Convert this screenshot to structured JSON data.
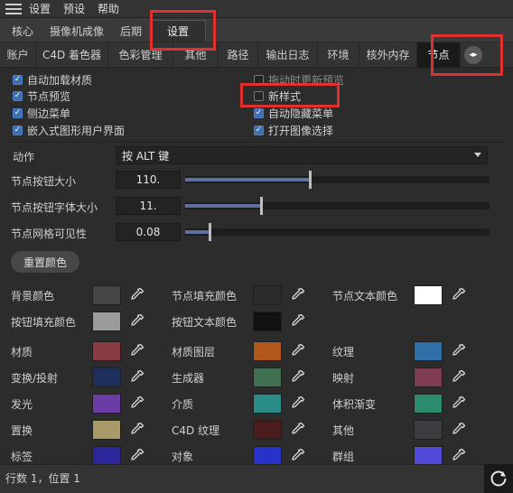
{
  "menubar": {
    "items": [
      "设置",
      "预设",
      "帮助"
    ]
  },
  "tabs_main": [
    {
      "label": "核心",
      "active": false
    },
    {
      "label": "摄像机成像",
      "active": false
    },
    {
      "label": "后期",
      "active": false
    },
    {
      "label": "设置",
      "active": true
    }
  ],
  "tabs_sub": [
    {
      "label": "账户",
      "active": false
    },
    {
      "label": "C4D 着色器",
      "active": false
    },
    {
      "label": "色彩管理",
      "active": false
    },
    {
      "label": "其他",
      "active": false
    },
    {
      "label": "路径",
      "active": false
    },
    {
      "label": "输出日志",
      "active": false
    },
    {
      "label": "环境",
      "active": false
    },
    {
      "label": "核外内存",
      "active": false
    },
    {
      "label": "节点",
      "active": true
    }
  ],
  "checkboxes": [
    {
      "label": "自动加载材质",
      "checked": true
    },
    {
      "label": "节点预览",
      "checked": true
    },
    {
      "label": "侧边菜单",
      "checked": true
    },
    {
      "label": "嵌入式图形用户界面",
      "checked": true
    },
    {
      "label": "拖动时更新预览",
      "checked": false
    },
    {
      "label": "新样式",
      "checked": false
    },
    {
      "label": "自动隐藏菜单",
      "checked": true
    },
    {
      "label": "打开图像选择",
      "checked": true
    }
  ],
  "action": {
    "label": "动作",
    "value": "按 ALT 键"
  },
  "sliders": [
    {
      "label": "节点按钮大小",
      "value": "110.",
      "fraction": 0.41
    },
    {
      "label": "节点按钮字体大小",
      "value": "11.",
      "fraction": 0.25
    },
    {
      "label": "节点网格可见性",
      "value": "0.08",
      "fraction": 0.08
    }
  ],
  "reset_button": "重置颜色",
  "colors": [
    {
      "label": "背景颜色",
      "color": "#454545"
    },
    {
      "label": "节点填充颜色",
      "color": "#2b2b2b"
    },
    {
      "label": "节点文本颜色",
      "color": "#ffffff"
    },
    {
      "label": "按钮填充颜色",
      "color": "#9c9c9c"
    },
    {
      "label": "按钮文本颜色",
      "color": "#111111"
    },
    {
      "label": "材质",
      "color": "#8a3c44"
    },
    {
      "label": "材质图层",
      "color": "#b0581c"
    },
    {
      "label": "纹理",
      "color": "#2f6ea6"
    },
    {
      "label": "变换/投射",
      "color": "#1f2f5c"
    },
    {
      "label": "生成器",
      "color": "#3f7050"
    },
    {
      "label": "映射",
      "color": "#7e3c55"
    },
    {
      "label": "发光",
      "color": "#6a3ca5"
    },
    {
      "label": "介质",
      "color": "#2a8c86"
    },
    {
      "label": "体积渐变",
      "color": "#2c8b6e"
    },
    {
      "label": "置换",
      "color": "#a99a6a"
    },
    {
      "label": "C4D 纹理",
      "color": "#4a1c1c"
    },
    {
      "label": "其他",
      "color": "#3e3c40"
    },
    {
      "label": "标签",
      "color": "#2b279a"
    },
    {
      "label": "对象",
      "color": "#2832c8"
    },
    {
      "label": "群组",
      "color": "#5149d8"
    }
  ],
  "status": {
    "text": "行数 1，位置 1"
  },
  "icons": {
    "menu": "hamburger-icon",
    "picker": "eyedropper-icon",
    "scroll": "tab-scroll-icon",
    "refresh": "refresh-icon",
    "dropdown": "chevron-down-icon",
    "check": "checkmark-icon"
  }
}
